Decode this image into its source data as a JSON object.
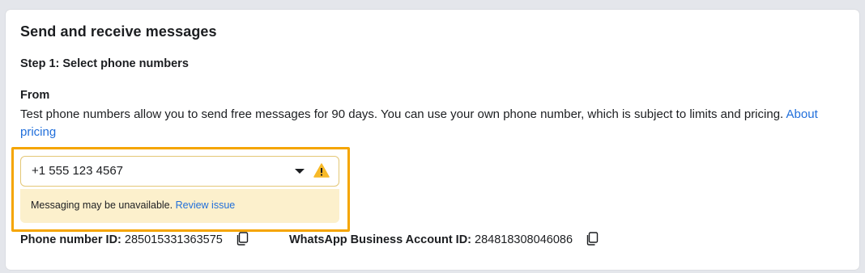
{
  "card": {
    "title": "Send and receive messages",
    "step": "Step 1: Select phone numbers",
    "from_label": "From",
    "description": "Test phone numbers allow you to send free messages for 90 days. You can use your own phone number, which is subject to limits and pricing.",
    "about_pricing_link": "About pricing"
  },
  "phone_select": {
    "value": "+1 555 123 4567",
    "warning_icon": "warning-triangle-icon",
    "caret_icon": "caret-down-icon"
  },
  "notice": {
    "text": "Messaging may be unavailable.",
    "link": "Review issue"
  },
  "ids": {
    "phone_id_label": "Phone number ID:",
    "phone_id_value": "285015331363575",
    "waba_id_label": "WhatsApp Business Account ID:",
    "waba_id_value": "284818308046086",
    "copy_icon": "copy-icon"
  },
  "colors": {
    "highlight_border": "#f5a500",
    "link": "#216fdb",
    "notice_bg": "#fcf0cc",
    "warning": "#f7b928"
  }
}
